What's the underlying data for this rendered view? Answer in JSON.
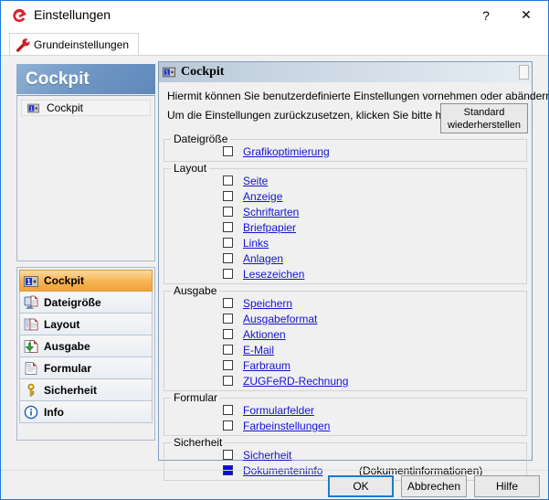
{
  "window": {
    "title": "Einstellungen",
    "logo_icon": "app-logo-e",
    "help_glyph": "?",
    "close_glyph": "✕"
  },
  "tabs": [
    {
      "label": "Grundeinstellungen",
      "icon": "wrench-icon",
      "selected": true
    }
  ],
  "sidebar": {
    "header": "Cockpit",
    "list": [
      {
        "label": "Cockpit",
        "icon": "cockpit-icon"
      }
    ],
    "nav": [
      {
        "label": "Cockpit",
        "icon": "cockpit-icon",
        "selected": true
      },
      {
        "label": "Dateigröße",
        "icon": "filesize-icon",
        "selected": false
      },
      {
        "label": "Layout",
        "icon": "layout-icon",
        "selected": false
      },
      {
        "label": "Ausgabe",
        "icon": "output-icon",
        "selected": false
      },
      {
        "label": "Formular",
        "icon": "form-icon",
        "selected": false
      },
      {
        "label": "Sicherheit",
        "icon": "key-icon",
        "selected": false
      },
      {
        "label": "Info",
        "icon": "info-icon",
        "selected": false
      }
    ]
  },
  "panel": {
    "title": "Cockpit",
    "title_icon": "cockpit-icon",
    "intro_line1": "Hiermit können Sie benutzerdefinierte Einstellungen vornehmen oder abändern.",
    "intro_line2": "Um die Einstellungen zurückzusetzen, klicken Sie bitte hier:",
    "restore_button_line1": "Standard",
    "restore_button_line2": "wiederherstellen",
    "groups": [
      {
        "title": "Dateigröße",
        "items": [
          {
            "label": "Grafikoptimierung",
            "checked": false,
            "note": ""
          }
        ]
      },
      {
        "title": "Layout",
        "items": [
          {
            "label": "Seite",
            "checked": false,
            "note": ""
          },
          {
            "label": "Anzeige",
            "checked": false,
            "note": ""
          },
          {
            "label": "Schriftarten",
            "checked": false,
            "note": ""
          },
          {
            "label": "Briefpapier",
            "checked": false,
            "note": ""
          },
          {
            "label": "Links",
            "checked": false,
            "note": ""
          },
          {
            "label": "Anlagen",
            "checked": false,
            "note": ""
          },
          {
            "label": "Lesezeichen",
            "checked": false,
            "note": ""
          }
        ]
      },
      {
        "title": "Ausgabe",
        "items": [
          {
            "label": "Speichern",
            "checked": false,
            "note": ""
          },
          {
            "label": "Ausgabeformat",
            "checked": false,
            "note": ""
          },
          {
            "label": "Aktionen",
            "checked": false,
            "note": ""
          },
          {
            "label": "E-Mail",
            "checked": false,
            "note": ""
          },
          {
            "label": "Farbraum",
            "checked": false,
            "note": ""
          },
          {
            "label": "ZUGFeRD-Rechnung",
            "checked": false,
            "note": ""
          }
        ]
      },
      {
        "title": "Formular",
        "items": [
          {
            "label": "Formularfelder",
            "checked": false,
            "note": ""
          },
          {
            "label": "Farbeinstellungen",
            "checked": false,
            "note": ""
          }
        ]
      },
      {
        "title": "Sicherheit",
        "items": [
          {
            "label": "Sicherheit",
            "checked": false,
            "note": ""
          },
          {
            "label": "Dokumenteninfo",
            "checked": true,
            "note": "(Dokumentinformationen)"
          }
        ]
      }
    ]
  },
  "footer": {
    "ok": "OK",
    "cancel": "Abbrechen",
    "help": "Hilfe"
  },
  "colors": {
    "accent_blue": "#1e7ad4",
    "link_blue": "#1414d2",
    "checked_blue": "#0b0bdc",
    "selected_orange": "#f7b450",
    "header_blue": "#6f96c4"
  }
}
